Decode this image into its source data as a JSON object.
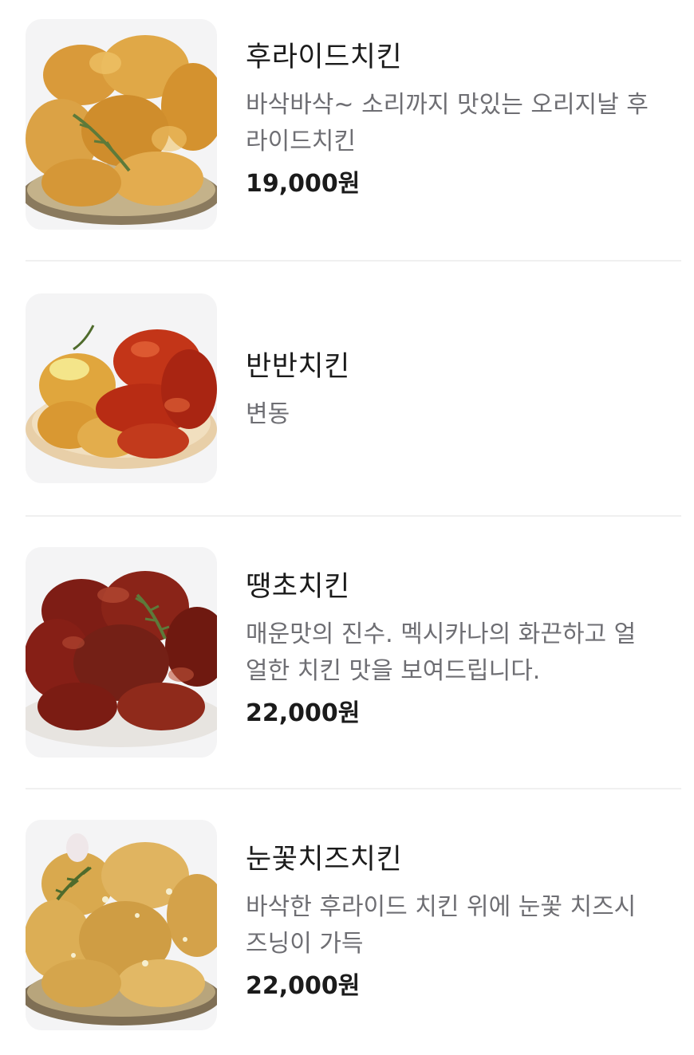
{
  "menu": {
    "items": [
      {
        "name": "후라이드치킨",
        "description_lines": [
          "바삭바삭~ 소리까지 맛있는 오리지날 후",
          "라이드치킨"
        ],
        "price": "19,000원",
        "image_icon": "fried-chicken-photo"
      },
      {
        "name": "반반치킨",
        "description_lines": [
          "변동"
        ],
        "price": "",
        "image_icon": "half-half-chicken-photo"
      },
      {
        "name": "땡초치킨",
        "description_lines": [
          "매운맛의 진수. 멕시카나의 화끈하고 얼",
          "얼한 치킨 맛을 보여드립니다."
        ],
        "price": "22,000원",
        "image_icon": "spicy-chicken-photo"
      },
      {
        "name": "눈꽃치즈치킨",
        "description_lines": [
          "바삭한 후라이드 치킨 위에 눈꽃 치즈시",
          "즈닝이 가득"
        ],
        "price": "22,000원",
        "image_icon": "snow-cheese-chicken-photo"
      }
    ]
  },
  "colors": {
    "background": "#ffffff",
    "card_background": "#f4f4f5",
    "divider": "#f0f0f0",
    "title_text": "#1b1b1b",
    "description_text": "#6e6e73",
    "fried_golden": "#d99a3a",
    "spicy_red": "#b8281a",
    "dark_glaze": "#7a1c14"
  }
}
